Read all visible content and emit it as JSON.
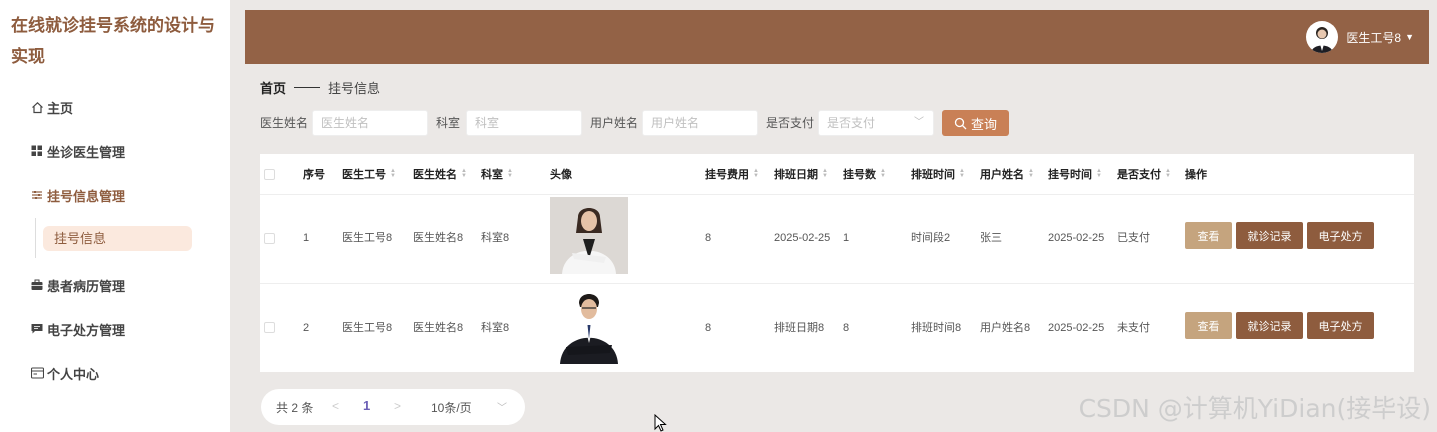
{
  "app": {
    "title": "在线就诊挂号系统的设计与实现"
  },
  "sidebar": {
    "items": [
      {
        "label": "主页",
        "icon": "home-icon"
      },
      {
        "label": "坐诊医生管理",
        "icon": "grid-icon"
      },
      {
        "label": "挂号信息管理",
        "icon": "sliders-icon"
      },
      {
        "label": "患者病历管理",
        "icon": "briefcase-icon"
      },
      {
        "label": "电子处方管理",
        "icon": "chat-icon"
      },
      {
        "label": "个人中心",
        "icon": "card-icon"
      }
    ],
    "sub_item": "挂号信息"
  },
  "header": {
    "username": "医生工号8"
  },
  "breadcrumb": {
    "home": "首页",
    "current": "挂号信息"
  },
  "search": {
    "doctor_label": "医生姓名",
    "doctor_placeholder": "医生姓名",
    "dept_label": "科室",
    "dept_placeholder": "科室",
    "user_label": "用户姓名",
    "user_placeholder": "用户姓名",
    "paid_label": "是否支付",
    "paid_placeholder": "是否支付",
    "query_label": "查询"
  },
  "table": {
    "headers": [
      "序号",
      "医生工号",
      "医生姓名",
      "科室",
      "头像",
      "挂号费用",
      "排班日期",
      "挂号数",
      "排班时间",
      "用户姓名",
      "挂号时间",
      "是否支付",
      "操作"
    ],
    "rows": [
      {
        "idx": "1",
        "doc_no": "医生工号8",
        "doc_name": "医生姓名8",
        "dept": "科室8",
        "fee": "8",
        "date": "2025-02-25",
        "count": "1",
        "time": "时间段2",
        "user": "张三",
        "reg_time": "2025-02-25",
        "paid": "已支付"
      },
      {
        "idx": "2",
        "doc_no": "医生工号8",
        "doc_name": "医生姓名8",
        "dept": "科室8",
        "fee": "8",
        "date": "排班日期8",
        "count": "8",
        "time": "排班时间8",
        "user": "用户姓名8",
        "reg_time": "2025-02-25",
        "paid": "未支付"
      }
    ],
    "actions": {
      "view": "查看",
      "record": "就诊记录",
      "rx": "电子处方"
    }
  },
  "pager": {
    "total": "共 2 条",
    "page": "1",
    "size": "10条/页"
  },
  "watermark": "CSDN @计算机YiDian(接毕设)",
  "colors": {
    "brand": "#936246",
    "accent": "#c98056",
    "button_dark": "#8e5c3e",
    "button_light": "#c5a47e"
  }
}
